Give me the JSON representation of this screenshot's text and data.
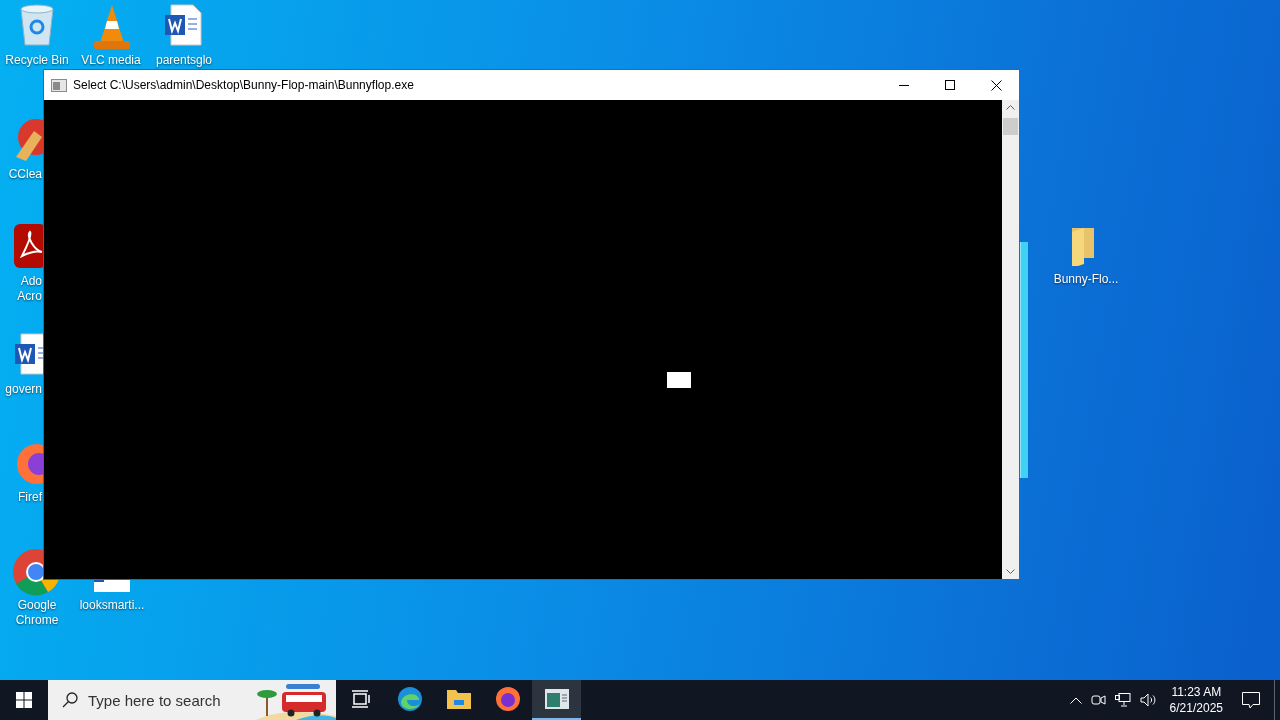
{
  "desktop_icons": [
    {
      "kind": "recycle",
      "lines": [
        "Recycle Bin"
      ]
    },
    {
      "kind": "vlc",
      "lines": [
        "VLC media"
      ]
    },
    {
      "kind": "word",
      "lines": [
        "parentsglo"
      ]
    },
    {
      "kind": "ccleaner",
      "lines": [
        "CClea"
      ]
    },
    {
      "kind": "acrobat",
      "lines": [
        "Ado",
        "Acro"
      ]
    },
    {
      "kind": "word",
      "lines": [
        "govern"
      ]
    },
    {
      "kind": "firefox",
      "lines": [
        "Firef"
      ]
    },
    {
      "kind": "chrome",
      "lines": [
        "Google",
        "Chrome"
      ]
    },
    {
      "kind": "document",
      "lines": [
        "looksmarti..."
      ]
    },
    {
      "kind": "folder",
      "lines": [
        "Bunny-Flo..."
      ]
    }
  ],
  "window": {
    "title": "Select C:\\Users\\admin\\Desktop\\Bunny-Flop-main\\Bunnyflop.exe",
    "cursor_visible": true
  },
  "taskbar": {
    "search": {
      "placeholder": "Type here to search"
    },
    "apps": [
      {
        "kind": "taskview",
        "selected": false
      },
      {
        "kind": "edge",
        "selected": false
      },
      {
        "kind": "explorer",
        "selected": false
      },
      {
        "kind": "firefox",
        "selected": false
      },
      {
        "kind": "console",
        "selected": true
      }
    ],
    "clock": {
      "time": "11:23 AM",
      "date": "6/21/2025"
    }
  }
}
